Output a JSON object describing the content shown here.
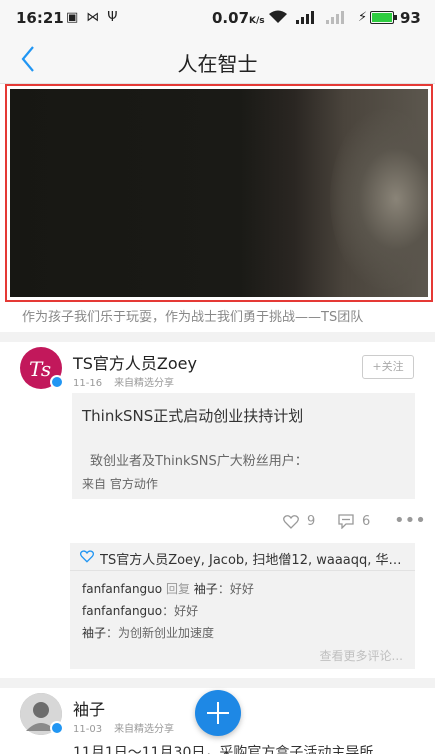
{
  "status": {
    "time": "16:21",
    "speed": "0.07",
    "speed_unit": "K/s",
    "battery": "93"
  },
  "nav": {
    "title": "人在智士",
    "back_icon": "chevron-left-icon"
  },
  "banner": {
    "caption": "作为孩子我们乐于玩耍，作为战士我们勇于挑战——TS团队"
  },
  "post1": {
    "author": "TS官方人员Zoey",
    "date": "11-16",
    "source": "来自精选分享",
    "follow_label": "+关注",
    "share": {
      "title": "ThinkSNS正式启动创业扶持计划",
      "body": "致创业者及ThinkSNS广大粉丝用户：",
      "from": "来自 官方动作"
    },
    "likes_count": "9",
    "comments_count": "6",
    "liked_by": "TS官方人员Zoey, Jacob, 扫地僧12, waaaqq, 华…",
    "comments": [
      {
        "name": "fanfanfanguo",
        "reply_word": "回复",
        "reply_to": "袖子",
        "text": "：好好"
      },
      {
        "name": "fanfanfanguo",
        "reply_word": "",
        "reply_to": "",
        "text": "：好好"
      },
      {
        "name": "袖子",
        "reply_word": "",
        "reply_to": "",
        "text": "：为创新创业加速度"
      }
    ],
    "view_more": "查看更多评论..."
  },
  "post2": {
    "author": "袖子",
    "date": "11-03",
    "source": "来自精选分享",
    "text_preview": "11月1日～11月30日，采购官方盒子活动主导所"
  },
  "colors": {
    "accent": "#2196f3",
    "highlight_border": "#e53935",
    "avatar_ts": "#c2185b"
  }
}
